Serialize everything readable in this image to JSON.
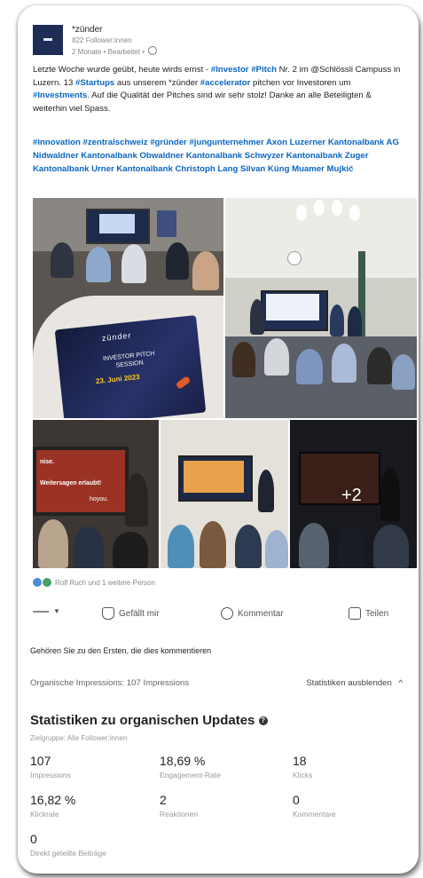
{
  "post": {
    "org_name": "*zünder",
    "followers": "822 Follower:innen",
    "meta": "2 Monate • Bearbeitet •",
    "text_parts": [
      {
        "t": "Letzte Woche wurde geübt, heute wirds ernst - ",
        "tag": false
      },
      {
        "t": "#Investor",
        "tag": true
      },
      {
        "t": " ",
        "tag": false
      },
      {
        "t": "#Pitch",
        "tag": true
      },
      {
        "t": " Nr. 2 im @Schlössli Campuss in Luzern. 13 ",
        "tag": false
      },
      {
        "t": "#Startups",
        "tag": true
      },
      {
        "t": " aus unserem *zünder ",
        "tag": false
      },
      {
        "t": "#accelerator",
        "tag": true
      },
      {
        "t": " pitchen vor Investoren um ",
        "tag": false
      },
      {
        "t": "#Investments",
        "tag": true
      },
      {
        "t": ". Auf die Qualität der Pitches sind wir sehr stolz! Danke an alle Beteiligten & weiterhin viel Spass.",
        "tag": false
      }
    ],
    "tags": "#innovation #zentralschweiz #gründer #jungunternehmer Axon Luzerner Kantonalbank AG Nidwaldner Kantonalbank Obwaldner Kantonalbank Schwyzer Kantonalbank Zuger Kantonalbank Urner Kantonalbank Christoph Lang Silvan Küng Muamer Mujkić"
  },
  "photos": {
    "booklet_brand": "zünder",
    "booklet_title": "INVESTOR PITCH SESSION",
    "booklet_date": "23. Juni 2023",
    "slide_line1": "nise.",
    "slide_line2": "Weitersagen erlaubt!",
    "slide_line3": "hoyou.",
    "more_count": "+2"
  },
  "reactions": "Rolf Ruch und 1 weitere Person",
  "actions": {
    "like": "Gefällt mir",
    "comment": "Kommentar",
    "share": "Teilen"
  },
  "first_comment": "Gehören Sie zu den Ersten, die dies kommentieren",
  "impressions_line": "Organische Impressions: 107 Impressions",
  "hide_stats": "Statistiken ausblenden",
  "stats": {
    "title": "Statistiken zu organischen Updates",
    "audience": "Zielgruppe: Alle Follower:innen",
    "items": [
      {
        "value": "107",
        "label": "Impressions"
      },
      {
        "value": "18,69 %",
        "label": "Engagement-Rate"
      },
      {
        "value": "18",
        "label": "Klicks"
      },
      {
        "value": "16,82 %",
        "label": "Klickrate"
      },
      {
        "value": "2",
        "label": "Reaktionen"
      },
      {
        "value": "0",
        "label": "Kommentare"
      },
      {
        "value": "0",
        "label": "Direkt geteilte Beiträge"
      }
    ]
  },
  "colors": {
    "link": "#0a66c2",
    "logo": "#1f2d54"
  }
}
